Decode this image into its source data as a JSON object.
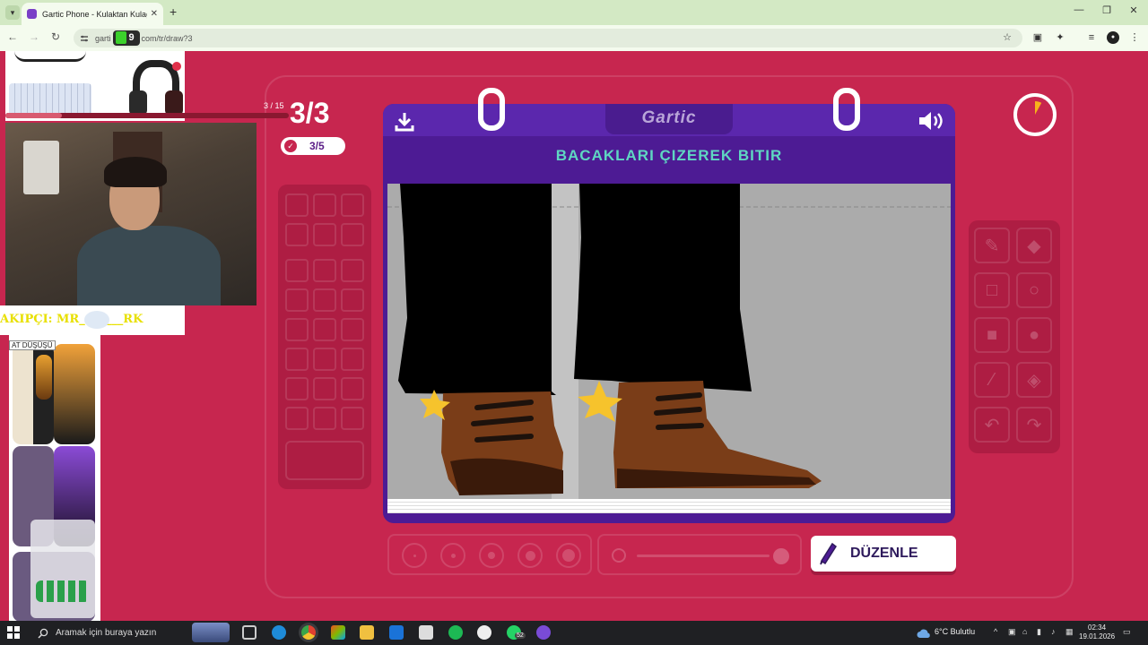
{
  "browser": {
    "tab_title": "Gartic Phone - Kulaktan Kulağa",
    "url": "gartic com/tr/draw?3",
    "url_prefix": "garti",
    "url_suffix": "com/tr/draw?3"
  },
  "overlay": {
    "progress_text": "3 / 15",
    "progress_fraction": 0.2,
    "banner_text": "AKIPÇI: MR_A_____RK",
    "ad_label": "AT DÜŞÜŞÜ",
    "watermark": "9"
  },
  "game": {
    "round": "3/3",
    "submitted": "3/5",
    "logo": "Gartic",
    "task": "BACAKLARI ÇIZEREK BITIR",
    "edit_button": "DÜZENLE",
    "timer_fraction": 0.08
  },
  "taskbar": {
    "search_placeholder": "Aramak için buraya yazın",
    "weather": "6°C Bulutlu",
    "time": "02:34",
    "date": "19.01.2026",
    "whatsapp_badge": "52"
  },
  "colors": {
    "page_bg": "#c7264f",
    "card": "#4d1b94",
    "task_text": "#5fd7c2",
    "boot": "#7a3d18"
  }
}
